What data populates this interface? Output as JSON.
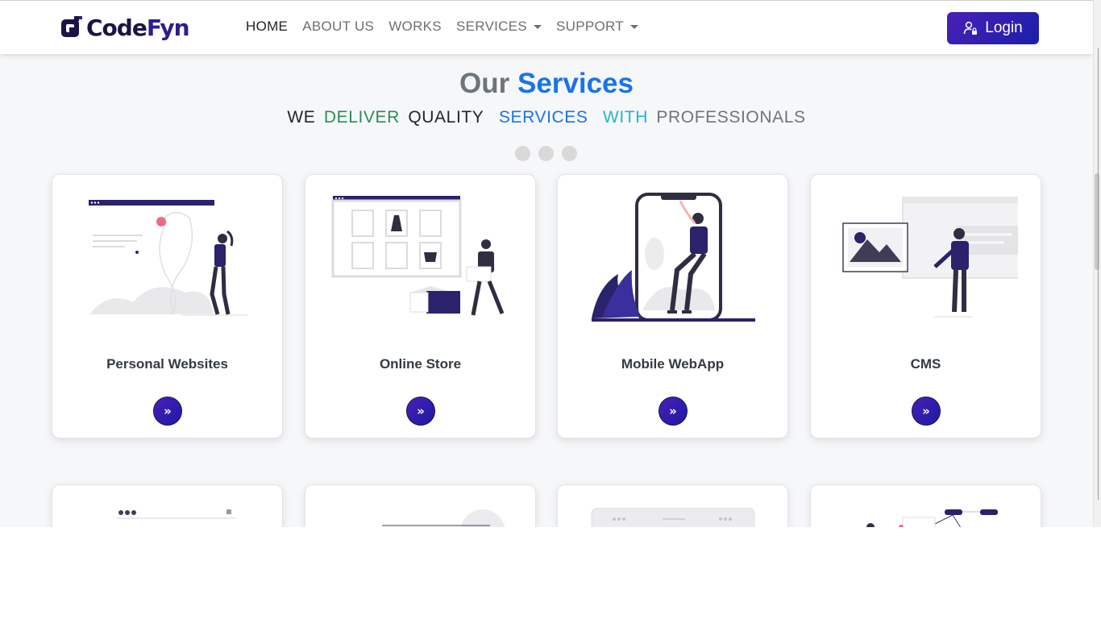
{
  "brand": {
    "code": "Code",
    "fyn": "Fyn",
    "logo_icon": "codefyn-logo-icon"
  },
  "nav": {
    "items": [
      {
        "label": "HOME",
        "active": true,
        "dropdown": false
      },
      {
        "label": "ABOUT US",
        "active": false,
        "dropdown": false
      },
      {
        "label": "WORKS",
        "active": false,
        "dropdown": false
      },
      {
        "label": "SERVICES",
        "active": false,
        "dropdown": true
      },
      {
        "label": "SUPPORT",
        "active": false,
        "dropdown": true
      }
    ],
    "login_label": "Login",
    "login_icon": "user-lock-icon"
  },
  "section": {
    "title_part1": "Our",
    "title_part2": "Services",
    "subtitle_words": [
      "WE",
      "DELIVER",
      "QUALITY",
      "SERVICES",
      "WITH",
      "PROFESSIONALS"
    ]
  },
  "cards": [
    {
      "title": "Personal Websites",
      "button": "»",
      "illustration": "personal-website-illustration"
    },
    {
      "title": "Online Store",
      "button": "»",
      "illustration": "online-store-illustration"
    },
    {
      "title": "Mobile WebApp",
      "button": "»",
      "illustration": "mobile-webapp-illustration"
    },
    {
      "title": "CMS",
      "button": "»",
      "illustration": "cms-illustration"
    }
  ],
  "colors": {
    "brand_dark": "#1a1446",
    "brand_purple": "#2b1f8e",
    "accent_blue": "#1a73e8",
    "accent_green": "#2e8b57",
    "accent_cyan": "#21b5d5",
    "muted": "#6c757d",
    "page_bg": "#f6f7f9"
  }
}
